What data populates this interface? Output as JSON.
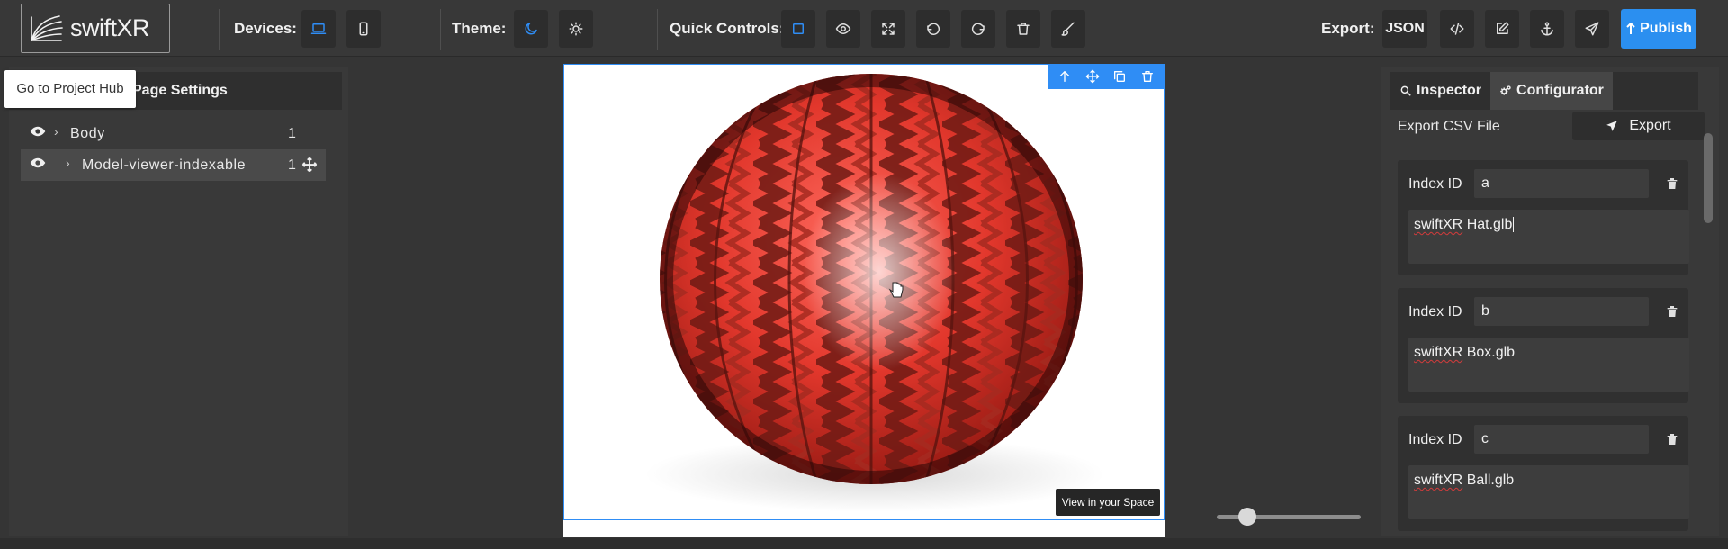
{
  "app": {
    "logo_text": "swiftXR"
  },
  "toolbar": {
    "devices_label": "Devices:",
    "theme_label": "Theme:",
    "quick_controls_label": "Quick Controls:",
    "export_label": "Export:",
    "json_label": "JSON",
    "publish_label": "Publish",
    "accent_color": "#2f8df5"
  },
  "tooltip": {
    "text": "Go to Project Hub"
  },
  "left_panel": {
    "title": "Page Settings",
    "tree": [
      {
        "name": "Body",
        "count": "1"
      },
      {
        "name": "Model-viewer-indexable",
        "count": "1"
      }
    ]
  },
  "canvas": {
    "view_in_space_label": "View in your Space",
    "zoom_slider_fraction": 0.21
  },
  "right_panel": {
    "tabs": [
      {
        "label": "Inspector",
        "icon": "search-icon"
      },
      {
        "label": "Configurator",
        "icon": "cogs-icon"
      }
    ],
    "export_csv_label": "Export CSV File",
    "export_button_label": "Export",
    "id_label": "Index ID",
    "items": [
      {
        "index_id": "a",
        "model_prefix": "swiftXR",
        "model_file": "Hat.glb"
      },
      {
        "index_id": "b",
        "model_prefix": "swiftXR",
        "model_file": "Box.glb"
      },
      {
        "index_id": "c",
        "model_prefix": "swiftXR",
        "model_file": "Ball.glb"
      }
    ]
  }
}
